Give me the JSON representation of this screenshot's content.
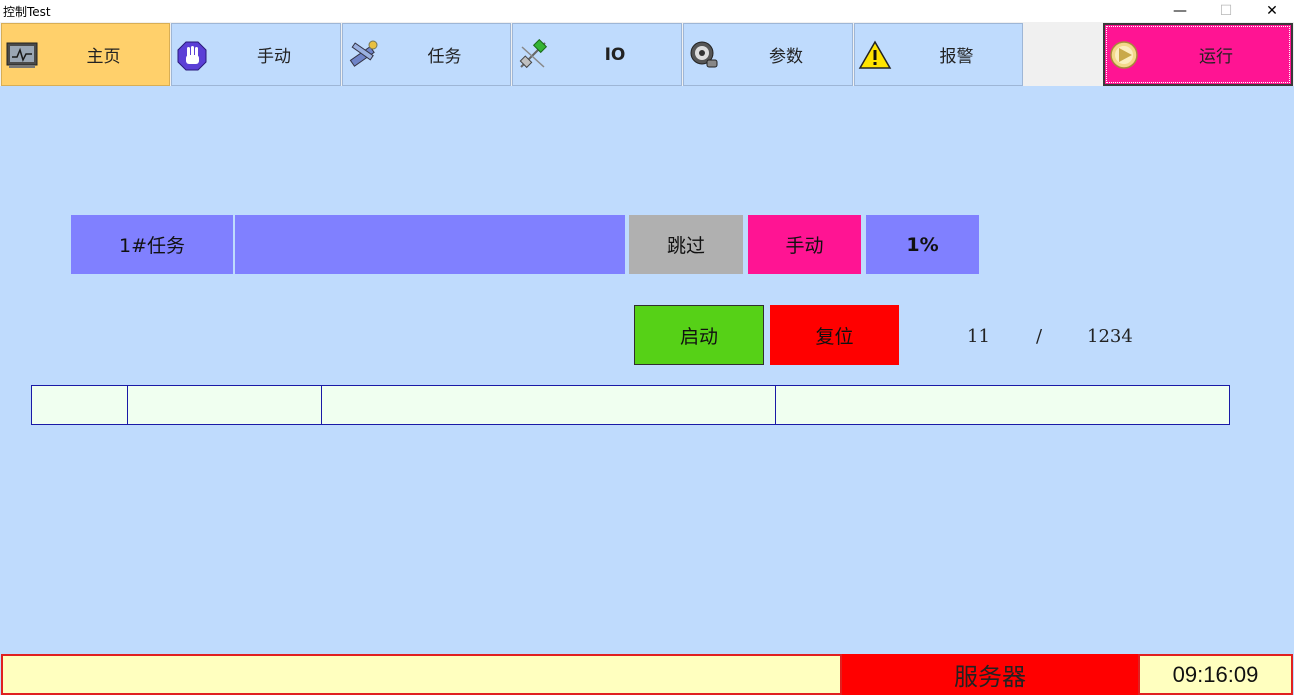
{
  "window": {
    "title": "控制Test",
    "min_glyph": "—",
    "max_glyph": "☐",
    "close_glyph": "✕"
  },
  "nav": {
    "items": [
      {
        "label": "主页",
        "icon": "monitor-icon",
        "active": true
      },
      {
        "label": "手动",
        "icon": "hand-icon",
        "active": false
      },
      {
        "label": "任务",
        "icon": "tools-icon",
        "active": false
      },
      {
        "label": "IO",
        "icon": "io-plug-icon",
        "active": false
      },
      {
        "label": "参数",
        "icon": "gear-icon",
        "active": false
      },
      {
        "label": "报警",
        "icon": "warning-icon",
        "active": false
      }
    ],
    "run": {
      "label": "运行",
      "icon": "run-icon"
    }
  },
  "task": {
    "label": "1#任务",
    "value": "",
    "skip_label": "跳过",
    "mode_label": "手动",
    "progress_text": "1%"
  },
  "controls": {
    "start_label": "启动",
    "reset_label": "复位"
  },
  "counter": {
    "current": "11",
    "separator": "/",
    "total": "1234"
  },
  "status": {
    "message": "",
    "server_label": "服务器",
    "time": "09:16:09"
  },
  "colors": {
    "panel_bg": "#bfdbfd",
    "nav_active": "#ffd06b",
    "run_bg": "#ff1493",
    "task_blue": "#8080ff",
    "skip_gray": "#b0b0b0",
    "start_green": "#56d117",
    "reset_red": "#ff0000",
    "status_yellow": "#ffffbf"
  }
}
